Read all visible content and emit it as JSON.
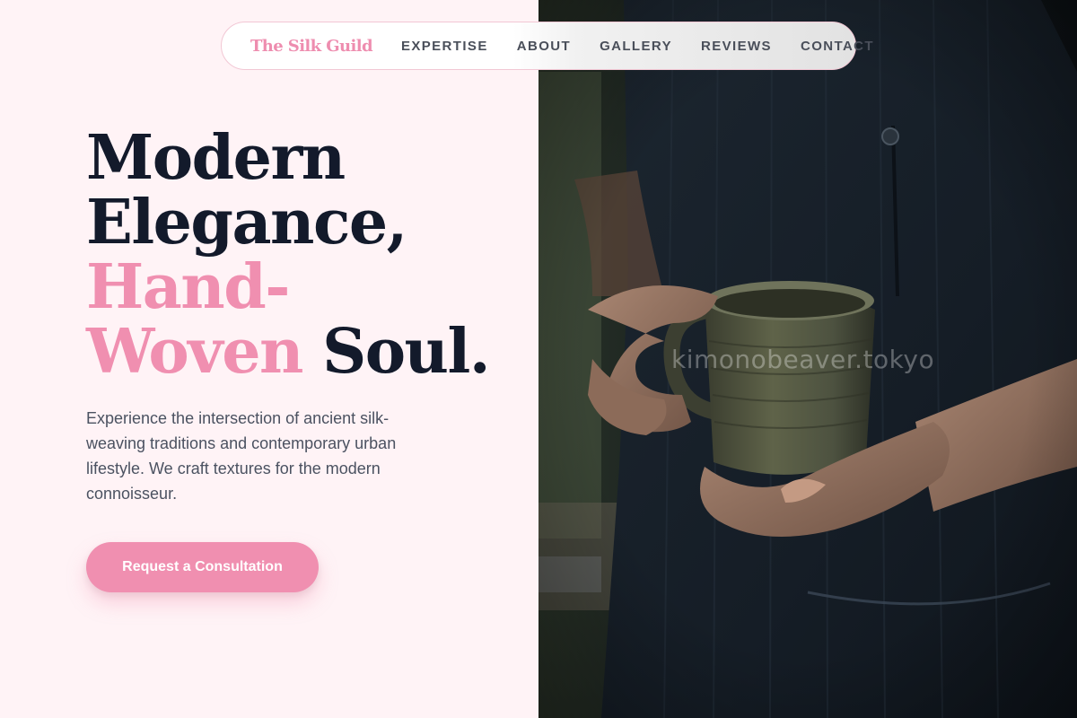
{
  "nav": {
    "brand": "The Silk Guild",
    "links": [
      "EXPERTISE",
      "ABOUT",
      "GALLERY",
      "REVIEWS",
      "CONTACT"
    ]
  },
  "hero": {
    "title_line1": "Modern",
    "title_line2": "Elegance,",
    "title_line3": "Hand-",
    "title_line4_pink": "Woven",
    "title_line4_dark": "Soul.",
    "description": "Experience the intersection of ancient silk-weaving traditions and contemporary urban lifestyle. We craft textures for the modern connoisseur.",
    "cta_label": "Request a Consultation"
  },
  "photo": {
    "watermark": "kimonobeaver.tokyo",
    "subject": "hands-holding-ceramic-mug"
  },
  "colors": {
    "background": "#fff3f6",
    "accent_pink": "#f08fb0",
    "heading_dark": "#131a2b",
    "body_text": "#4b5261"
  }
}
